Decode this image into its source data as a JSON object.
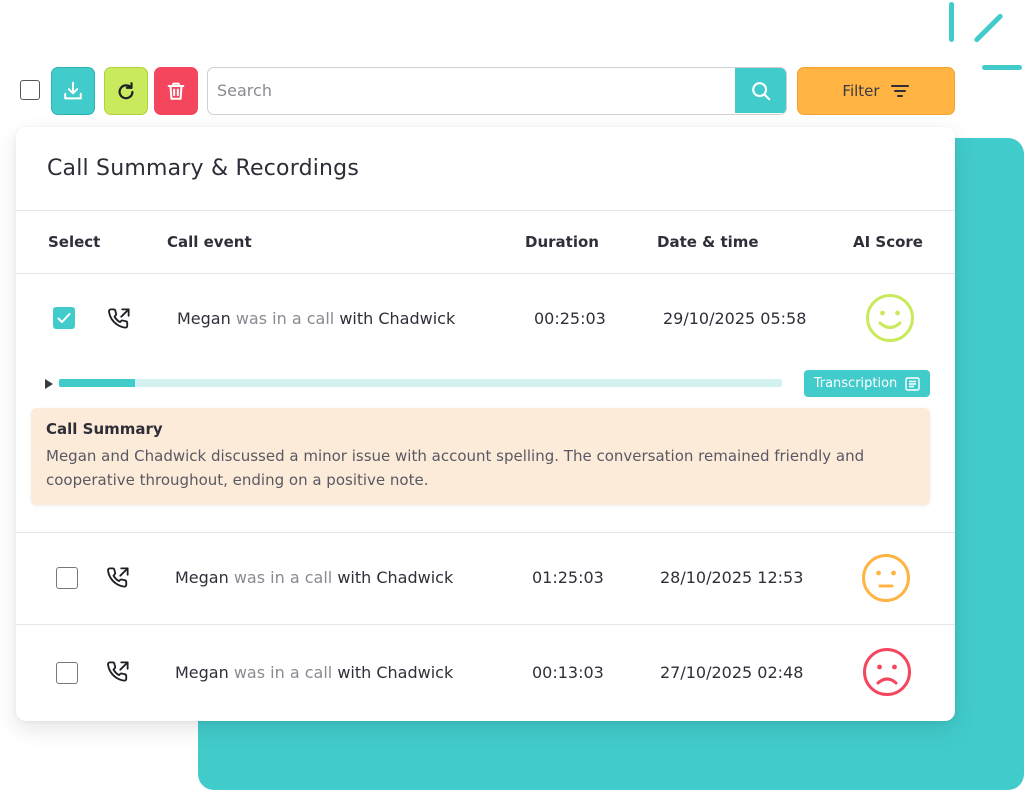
{
  "toolbar": {
    "search_placeholder": "Search",
    "filter_label": "Filter"
  },
  "card": {
    "title": "Call Summary & Recordings",
    "columns": {
      "select": "Select",
      "event": "Call event",
      "duration": "Duration",
      "datetime": "Date & time",
      "score": "AI Score"
    }
  },
  "rows": [
    {
      "checked": true,
      "caller": "Megan",
      "verb": "was in a call",
      "callee": "with Chadwick",
      "duration": "00:25:03",
      "datetime": "29/10/2025 05:58",
      "score": "happy"
    },
    {
      "checked": false,
      "caller": "Megan",
      "verb": "was in a call",
      "callee": "with Chadwick",
      "duration": "01:25:03",
      "datetime": "28/10/2025 12:53",
      "score": "neutral"
    },
    {
      "checked": false,
      "caller": "Megan",
      "verb": "was in a call",
      "callee": "with Chadwick",
      "duration": "00:13:03",
      "datetime": "27/10/2025 02:48",
      "score": "sad"
    }
  ],
  "player": {
    "progress_fraction": 0.105,
    "transcription_label": "Transcription"
  },
  "summary": {
    "title": "Call Summary",
    "text": "Megan and Chadwick discussed a minor issue with account spelling. The conversation remained friendly and cooperative throughout, ending on a positive note."
  },
  "icons": {
    "download": "download-icon",
    "refresh": "refresh-icon",
    "delete": "trash-icon",
    "search": "search-icon",
    "filter": "filter-icon",
    "call": "outgoing-call-icon",
    "transcript": "document-icon",
    "faces": [
      "happy-face-icon",
      "neutral-face-icon",
      "sad-face-icon"
    ]
  },
  "colors": {
    "teal": "#42cbcb",
    "lime": "#c9ea5c",
    "red": "#f4475e",
    "orange": "#ffb443",
    "score_happy": "#c9ea5c",
    "score_neutral": "#ffb443",
    "score_sad": "#f4475e",
    "summary_bg": "#fdebd9"
  }
}
